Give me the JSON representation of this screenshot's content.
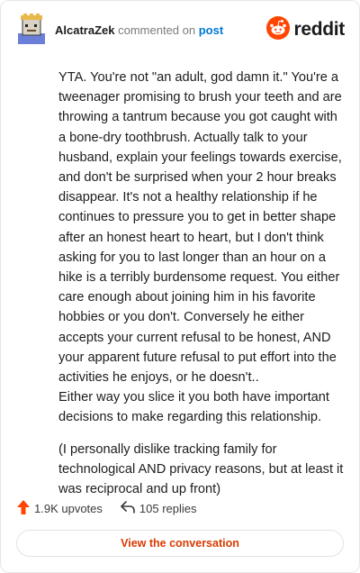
{
  "header": {
    "username": "AlcatraZek",
    "verb": "commented on",
    "post_link": "post",
    "brand": "reddit",
    "brand_color": "#ff4500"
  },
  "comment": {
    "paragraphs": [
      "YTA. You're not \"an adult, god damn it.\" You're a tweenager promising to brush your teeth and are throwing a tantrum because you got caught with a bone-dry toothbrush. Actually talk to your husband, explain your feelings towards exercise, and don't be surprised when your 2 hour breaks disappear. It's not a healthy relationship if he continues to pressure you to get in better shape after an honest heart to heart, but I don't think asking for you to last longer than an hour on a hike is a terribly burdensome request. You either care enough about joining him in his favorite hobbies or you don't. Conversely he either accepts your current refusal to be honest, AND your apparent future refusal to put effort into the activities he enjoys, or he doesn't..",
      "Either way you slice it you both have important decisions to make regarding this relationship.",
      "(I personally dislike tracking family for technological AND privacy reasons, but at least it was reciprocal and up front)"
    ]
  },
  "actions": {
    "upvotes": "1.9K upvotes",
    "replies": "105 replies",
    "upvote_color": "#ff4500"
  },
  "footer": {
    "view_label": "View the conversation",
    "view_color": "#d93a00"
  }
}
